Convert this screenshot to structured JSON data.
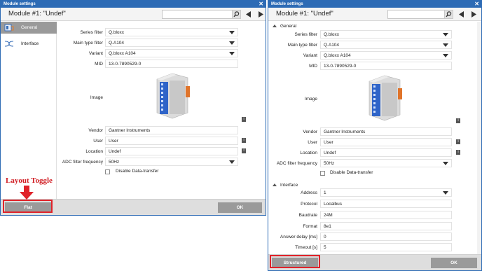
{
  "left_window": {
    "title": "Module settings",
    "close_glyph": "✕",
    "module_title": "Module #1: \"Undef\"",
    "search_placeholder": "",
    "sidebar": [
      {
        "label": "General",
        "icon": "module-icon",
        "active": true
      },
      {
        "label": "Interface",
        "icon": "interface-icon",
        "active": false
      }
    ],
    "fields": {
      "series_filter": {
        "label": "Series filter",
        "value": "Q.bloxx"
      },
      "main_type_filter": {
        "label": "Main type filter",
        "value": "Q.A104"
      },
      "variant": {
        "label": "Variant",
        "value": "Q.bloxx A104"
      },
      "mid": {
        "label": "MID",
        "value": "13-0-7890529-0"
      },
      "image": {
        "label": "Image"
      },
      "vendor": {
        "label": "Vendor",
        "value": "Gantner Instruments"
      },
      "user": {
        "label": "User",
        "value": "User"
      },
      "location": {
        "label": "Location",
        "value": "Undef"
      },
      "adc": {
        "label": "ADC filter frequency",
        "value": "50Hz"
      }
    },
    "checkbox_label": "Disable Data-transfer",
    "info_glyph": "i",
    "toggle_button": "Flat",
    "ok_button": "OK"
  },
  "annotation": {
    "text": "Layout Toggle",
    "color": "#d01c22"
  },
  "right_window": {
    "title": "Module settings",
    "close_glyph": "✕",
    "module_title": "Module #1: \"Undef\"",
    "search_placeholder": "",
    "general_section": "General",
    "interface_section": "Interface",
    "fields": {
      "series_filter": {
        "label": "Series filter",
        "value": "Q.bloxx"
      },
      "main_type_filter": {
        "label": "Main type filter",
        "value": "Q.A104"
      },
      "variant": {
        "label": "Variant",
        "value": "Q.bloxx A104"
      },
      "mid": {
        "label": "MID",
        "value": "13-0-7890529-0"
      },
      "image": {
        "label": "Image"
      },
      "vendor": {
        "label": "Vendor",
        "value": "Gantner Instruments"
      },
      "user": {
        "label": "User",
        "value": "User"
      },
      "location": {
        "label": "Location",
        "value": "Undef"
      },
      "adc": {
        "label": "ADC filter frequency",
        "value": "50Hz"
      }
    },
    "checkbox_label": "Disable Data-transfer",
    "interface_fields": {
      "address": {
        "label": "Address",
        "value": "1"
      },
      "protocol": {
        "label": "Protocol",
        "value": "Localbus"
      },
      "baudrate": {
        "label": "Baudrate",
        "value": "24M"
      },
      "format": {
        "label": "Format",
        "value": "8e1"
      },
      "answer_delay": {
        "label": "Answer delay [ms]",
        "value": "0"
      },
      "timeout": {
        "label": "Timeout [s]",
        "value": "5"
      }
    },
    "info_glyph": "i",
    "toggle_button": "Structured",
    "ok_button": "OK"
  },
  "colors": {
    "titlebar": "#2d6bb5",
    "annotation_red": "#e0232a",
    "button_gray": "#9a9a9a"
  }
}
